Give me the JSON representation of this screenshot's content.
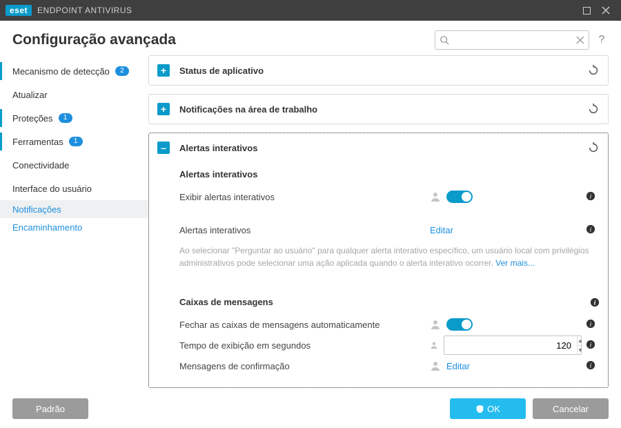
{
  "titlebar": {
    "brand": "eset",
    "title": "ENDPOINT ANTIVIRUS"
  },
  "header": {
    "page_title": "Configuração avançada",
    "search_placeholder": "",
    "help_glyph": "?"
  },
  "sidebar": {
    "items": [
      {
        "label": "Mecanismo de detecção",
        "badge": "2"
      },
      {
        "label": "Atualizar"
      },
      {
        "label": "Proteções",
        "badge": "1"
      },
      {
        "label": "Ferramentas",
        "badge": "1"
      },
      {
        "label": "Conectividade"
      },
      {
        "label": "Interface do usuário"
      },
      {
        "label": "Notificações"
      },
      {
        "label": "Encaminhamento"
      }
    ]
  },
  "content": {
    "edit_label": "Editar",
    "see_more_label": "Ver mais...",
    "sections": [
      {
        "title": "Status de aplicativo",
        "expanded": false
      },
      {
        "title": "Notificações na área de trabalho",
        "expanded": false
      },
      {
        "title": "Alertas interativos",
        "expanded": true,
        "group1": {
          "heading": "Alertas interativos",
          "rows": [
            {
              "label": "Exibir alertas interativos",
              "toggle": true
            },
            {
              "label": "Alertas interativos"
            }
          ],
          "fineprint": "Ao selecionar \"Perguntar ao usuário\" para qualquer alerta interativo específico, um usuário local com privilégios administrativos pode selecionar uma ação aplicada quando o alerta interativo ocorrer. "
        },
        "group2": {
          "heading": "Caixas de mensagens",
          "rows": [
            {
              "label": "Fechar as caixas de mensagens automaticamente",
              "toggle": true
            },
            {
              "label": "Tempo de exibição em segundos",
              "value": "120"
            },
            {
              "label": "Mensagens de confirmação"
            }
          ]
        }
      }
    ]
  },
  "footer": {
    "default_label": "Padrão",
    "ok_label": "OK",
    "cancel_label": "Cancelar"
  }
}
